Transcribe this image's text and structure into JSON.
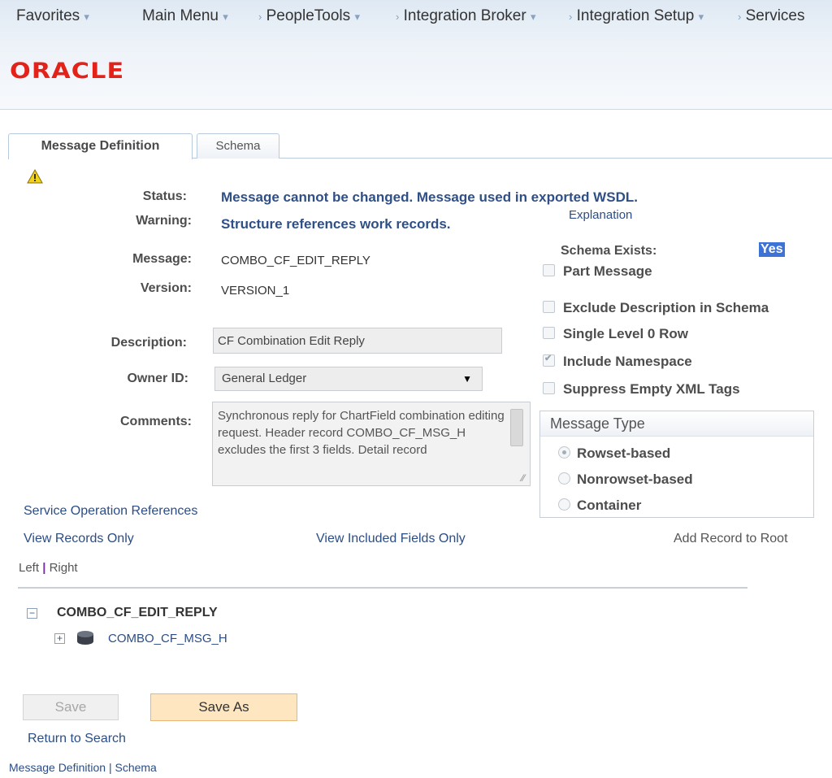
{
  "breadcrumb": {
    "favorites": "Favorites",
    "main_menu": "Main Menu",
    "peopletools": "PeopleTools",
    "integration_broker": "Integration Broker",
    "integration_setup": "Integration Setup",
    "services": "Services"
  },
  "logo": {
    "text": "ORACLE",
    "color": "#e3231a"
  },
  "tabs": [
    {
      "label": "Message Definition",
      "active": true
    },
    {
      "label": "Schema",
      "active": false
    }
  ],
  "form": {
    "status_label": "Status:",
    "status_value": "Message cannot be changed.  Message used in exported WSDL.",
    "warning_label": "Warning:",
    "warning_value": "Structure references work records.",
    "explanation_link": "Explanation",
    "message_label": "Message:",
    "message_value": "COMBO_CF_EDIT_REPLY",
    "version_label": "Version:",
    "version_value": "VERSION_1",
    "description_label": "Description:",
    "description_value": "CF Combination Edit Reply",
    "owner_label": "Owner ID:",
    "owner_value": "General Ledger",
    "comments_label": "Comments:",
    "comments_value": "Synchronous reply for ChartField combination editing request. Header record COMBO_CF_MSG_H excludes the first 3 fields.  Detail record"
  },
  "schema": {
    "exists_label": "Schema Exists:",
    "exists_value": "Yes",
    "options": [
      {
        "label": "Part Message",
        "checked": false
      },
      {
        "label": "Exclude Description in Schema",
        "checked": false
      },
      {
        "label": "Single Level 0 Row",
        "checked": false
      },
      {
        "label": "Include Namespace",
        "checked": true
      },
      {
        "label": "Suppress Empty XML Tags",
        "checked": false
      }
    ]
  },
  "message_type": {
    "title": "Message Type",
    "options": [
      {
        "label": "Rowset-based",
        "selected": true
      },
      {
        "label": "Nonrowset-based",
        "selected": false
      },
      {
        "label": "Container",
        "selected": false
      }
    ]
  },
  "links": {
    "service_operation_refs": "Service Operation References",
    "view_records_only": "View Records Only",
    "view_included_fields": "View Included Fields Only",
    "add_record_to_root": "Add Record to Root",
    "left": "Left",
    "right": "Right"
  },
  "tree": {
    "root": "COMBO_CF_EDIT_REPLY",
    "child": "COMBO_CF_MSG_H"
  },
  "buttons": {
    "save": "Save",
    "save_as": "Save As"
  },
  "footer": {
    "return_to_search": "Return to Search",
    "bottom_link_1": "Message Definition",
    "bottom_link_2": "Schema"
  }
}
